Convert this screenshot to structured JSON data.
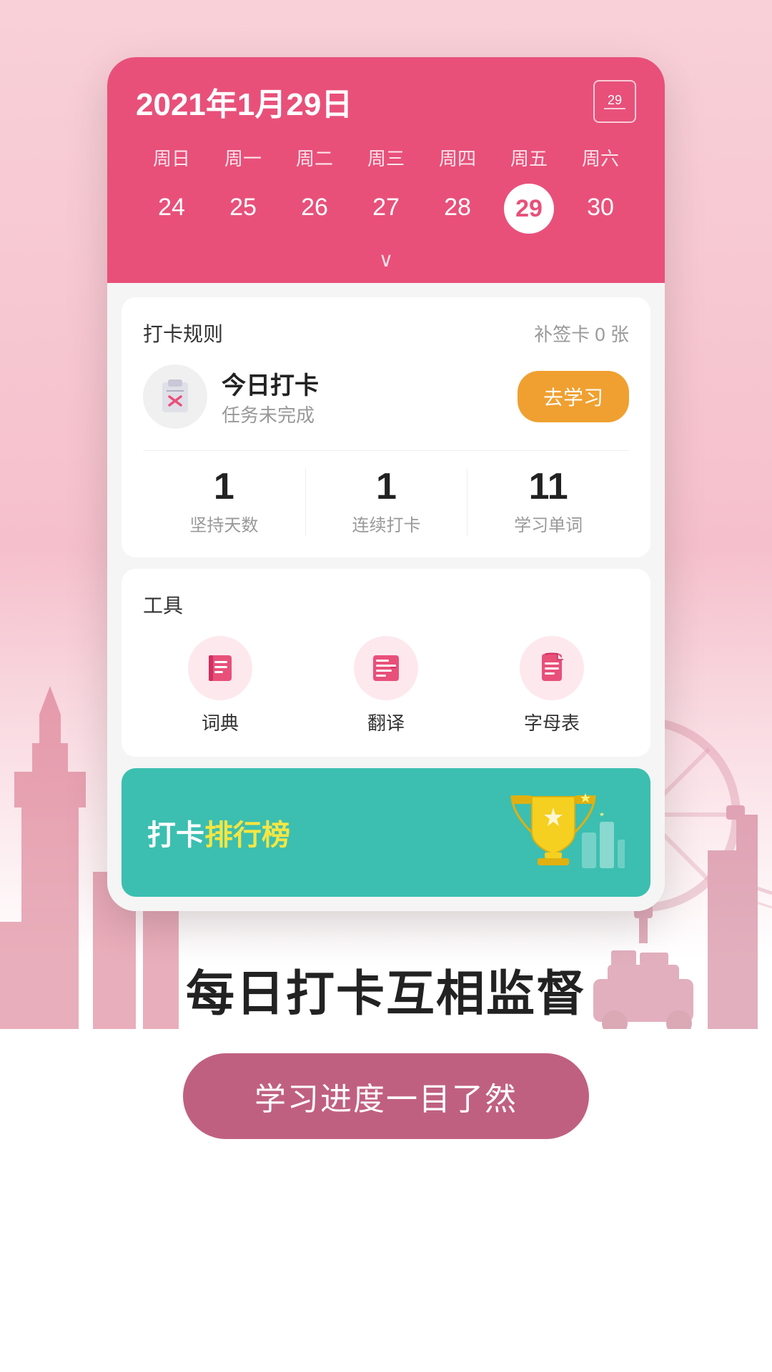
{
  "calendar": {
    "title": "2021年1月29日",
    "icon_label": "29",
    "weekdays": [
      "周日",
      "周一",
      "周二",
      "周三",
      "周四",
      "周五",
      "周六"
    ],
    "dates": [
      "24",
      "25",
      "26",
      "27",
      "28",
      "29",
      "30"
    ],
    "active_date": "29",
    "chevron": "∨"
  },
  "checkin_card": {
    "rules_label": "打卡规则",
    "supplement_label": "补签卡 0 张",
    "today_label": "今日打卡",
    "task_label": "任务未完成",
    "go_study_btn": "去学习",
    "stats": [
      {
        "number": "1",
        "label": "坚持天数"
      },
      {
        "number": "1",
        "label": "连续打卡"
      },
      {
        "number": "11",
        "label": "学习单词"
      }
    ]
  },
  "tools_card": {
    "title": "工具",
    "tools": [
      {
        "label": "词典",
        "icon": "book"
      },
      {
        "label": "翻译",
        "icon": "translate"
      },
      {
        "label": "字母表",
        "icon": "alphabet"
      }
    ]
  },
  "leaderboard": {
    "text_plain": "打卡",
    "text_highlight": "排行榜"
  },
  "bottom": {
    "slogan": "每日打卡互相监督",
    "cta": "学习进度一目了然"
  }
}
